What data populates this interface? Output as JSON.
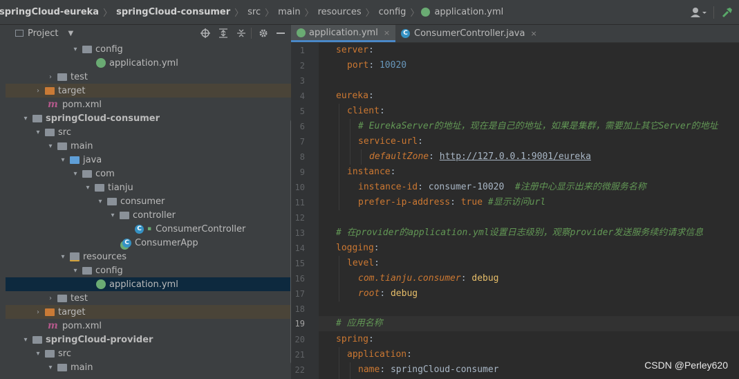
{
  "breadcrumb": {
    "items": [
      "springCloud-eureka",
      "springCloud-consumer",
      "src",
      "main",
      "resources",
      "config",
      "application.yml"
    ],
    "separator": "〉"
  },
  "project_panel": {
    "title": "Project"
  },
  "tree": [
    {
      "label": "config",
      "icon": "folder-icon",
      "expanded": true,
      "arrow": "▾"
    },
    {
      "label": "application.yml",
      "icon": "yaml-file-icon"
    },
    {
      "label": "test",
      "icon": "folder-icon",
      "arrow": "›"
    },
    {
      "label": "target",
      "icon": "excluded-folder-icon",
      "arrow": "›"
    },
    {
      "label": "pom.xml",
      "icon": "maven-icon"
    },
    {
      "label": "springCloud-consumer",
      "icon": "module-folder-icon",
      "arrow": "▾"
    },
    {
      "label": "src",
      "icon": "folder-icon",
      "arrow": "▾"
    },
    {
      "label": "main",
      "icon": "folder-icon",
      "arrow": "▾"
    },
    {
      "label": "java",
      "icon": "source-folder-icon",
      "arrow": "▾"
    },
    {
      "label": "com",
      "icon": "package-icon",
      "arrow": "▾"
    },
    {
      "label": "tianju",
      "icon": "package-icon",
      "arrow": "▾"
    },
    {
      "label": "consumer",
      "icon": "package-icon",
      "arrow": "▾"
    },
    {
      "label": "controller",
      "icon": "package-icon",
      "arrow": "▾"
    },
    {
      "label": "ConsumerController",
      "icon": "class-icon"
    },
    {
      "label": "ConsumerApp",
      "icon": "spring-boot-class-icon"
    },
    {
      "label": "resources",
      "icon": "resources-folder-icon",
      "arrow": "▾"
    },
    {
      "label": "config",
      "icon": "folder-icon",
      "arrow": "▾"
    },
    {
      "label": "application.yml",
      "icon": "yaml-file-icon"
    },
    {
      "label": "test",
      "icon": "folder-icon",
      "arrow": "›"
    },
    {
      "label": "target",
      "icon": "excluded-folder-icon",
      "arrow": "›"
    },
    {
      "label": "pom.xml",
      "icon": "maven-icon"
    },
    {
      "label": "springCloud-provider",
      "icon": "module-folder-icon",
      "arrow": "▾"
    },
    {
      "label": "src",
      "icon": "folder-icon",
      "arrow": "▾"
    },
    {
      "label": "main",
      "icon": "folder-icon",
      "arrow": "▾"
    }
  ],
  "editor_tabs": [
    {
      "label": "application.yml",
      "active": true,
      "close": "×"
    },
    {
      "label": "ConsumerController.java",
      "active": false,
      "close": "×"
    }
  ],
  "code_lines": [
    {
      "n": "1"
    },
    {
      "n": "2"
    },
    {
      "n": "3"
    },
    {
      "n": "4"
    },
    {
      "n": "5"
    },
    {
      "n": "6"
    },
    {
      "n": "7"
    },
    {
      "n": "8"
    },
    {
      "n": "9"
    },
    {
      "n": "10"
    },
    {
      "n": "11"
    },
    {
      "n": "12"
    },
    {
      "n": "13"
    },
    {
      "n": "14"
    },
    {
      "n": "15"
    },
    {
      "n": "16"
    },
    {
      "n": "17"
    },
    {
      "n": "18"
    },
    {
      "n": "19"
    },
    {
      "n": "20"
    },
    {
      "n": "21"
    },
    {
      "n": "22"
    }
  ],
  "code": {
    "l1": "server",
    "l2_key": "port",
    "l2_val": "10020",
    "l4": "eureka",
    "l5": "client",
    "l6": "# EurekaServer的地址，现在是自己的地址，如果是集群，需要加上其它Server的地址",
    "l7": "service-url",
    "l8_key": "defaultZone",
    "l8_val": "http://127.0.0.1:9001/eureka",
    "l9": "instance",
    "l10_key": "instance-id",
    "l10_val": "consumer-10020",
    "l10_comment": "#注册中心显示出来的微服务名称",
    "l11_key": "prefer-ip-address",
    "l11_val": "true",
    "l11_comment": "#显示访问url",
    "l13": "# 在provider的application.yml设置日志级别，观察provider发送服务续约请求信息",
    "l14": "logging",
    "l15": "level",
    "l16_key": "com.tianju.consumer",
    "l16_val": "debug",
    "l17_key": "root",
    "l17_val": "debug",
    "l19": "# 应用名称",
    "l20": "spring",
    "l21": "application",
    "l22_key": "name",
    "l22_val": "springCloud-consumer"
  },
  "watermark": "CSDN @Perley620",
  "colors": {
    "keyword": "#cc7832",
    "number": "#6897bb",
    "comment": "#629755",
    "selection": "#0d293e"
  }
}
